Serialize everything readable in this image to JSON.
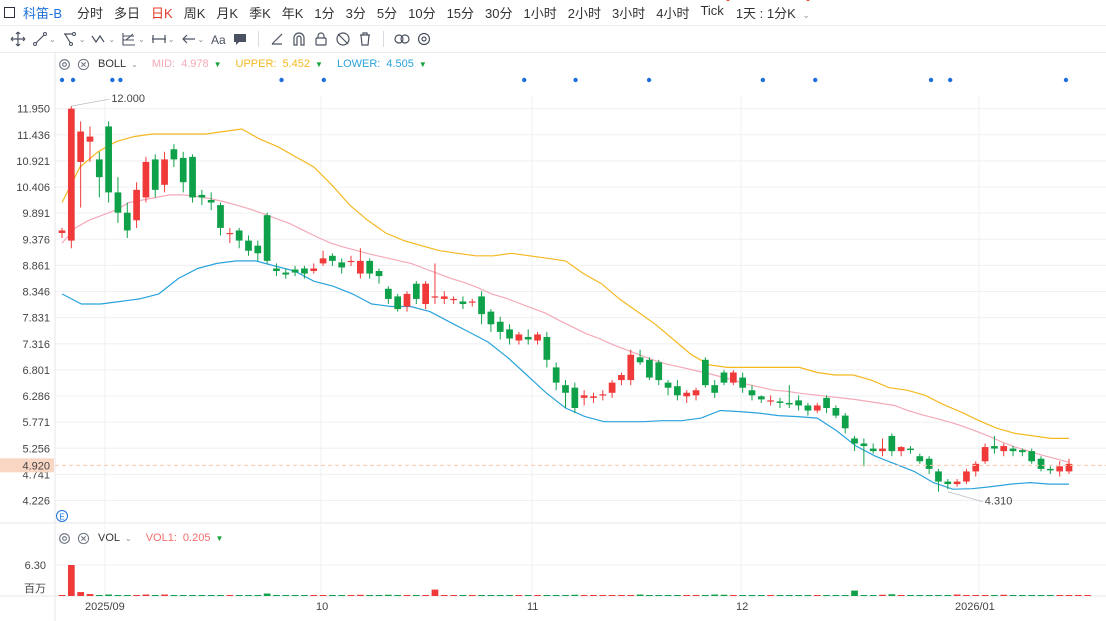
{
  "topbar": {
    "symbol": "科笛-B",
    "periods": [
      {
        "label": "分时",
        "active": false,
        "dot": false
      },
      {
        "label": "多日",
        "active": false,
        "dot": false
      },
      {
        "label": "日K",
        "active": true,
        "dot": false
      },
      {
        "label": "周K",
        "active": false,
        "dot": false
      },
      {
        "label": "月K",
        "active": false,
        "dot": false
      },
      {
        "label": "季K",
        "active": false,
        "dot": false
      },
      {
        "label": "年K",
        "active": false,
        "dot": false
      },
      {
        "label": "1分",
        "active": false,
        "dot": false
      },
      {
        "label": "3分",
        "active": false,
        "dot": false
      },
      {
        "label": "5分",
        "active": false,
        "dot": false
      },
      {
        "label": "10分",
        "active": false,
        "dot": false
      },
      {
        "label": "15分",
        "active": false,
        "dot": false
      },
      {
        "label": "30分",
        "active": false,
        "dot": false
      },
      {
        "label": "1小时",
        "active": false,
        "dot": false
      },
      {
        "label": "2小时",
        "active": false,
        "dot": false
      },
      {
        "label": "3小时",
        "active": false,
        "dot": false
      },
      {
        "label": "4小时",
        "active": false,
        "dot": false
      },
      {
        "label": "Tick",
        "active": false,
        "dot": true
      }
    ],
    "selector_label": "1天 : 1分K",
    "selector_dot": true
  },
  "toolbar": {
    "tools": [
      {
        "icon": "crosshair-move-icon",
        "caret": false
      },
      {
        "icon": "line-tool-icon",
        "caret": true
      },
      {
        "icon": "polyline-tool-icon",
        "caret": true
      },
      {
        "icon": "wave-pattern-icon",
        "caret": true
      },
      {
        "icon": "fibonacci-icon",
        "caret": true
      },
      {
        "icon": "measure-range-icon",
        "caret": true
      },
      {
        "icon": "arrow-left-icon",
        "caret": true
      },
      {
        "icon": "text-tool-icon",
        "caret": false
      },
      {
        "icon": "comment-icon",
        "caret": false
      },
      {
        "icon": "sep",
        "caret": false
      },
      {
        "icon": "angle-icon",
        "caret": false
      },
      {
        "icon": "magnet-icon",
        "caret": false
      },
      {
        "icon": "lock-icon",
        "caret": false
      },
      {
        "icon": "hide-icon",
        "caret": false
      },
      {
        "icon": "trash-icon",
        "caret": false
      },
      {
        "icon": "sep",
        "caret": false
      },
      {
        "icon": "link-icon",
        "caret": false
      },
      {
        "icon": "settings-icon",
        "caret": false
      }
    ]
  },
  "boll_legend": {
    "name": "BOLL",
    "mid_label": "MID:",
    "mid_value": "4.978",
    "upper_label": "UPPER:",
    "upper_value": "5.452",
    "lower_label": "LOWER:",
    "lower_value": "4.505",
    "colors": {
      "mid": "#f4a9b8",
      "upper": "#f5b821",
      "lower": "#2aa3dc"
    }
  },
  "vol_legend": {
    "name": "VOL",
    "vol1_label": "VOL1:",
    "vol1_value": "0.205",
    "color": "#f26d6d"
  },
  "price_axis": {
    "labels": [
      "11.950",
      "11.436",
      "10.921",
      "10.406",
      "9.891",
      "9.376",
      "8.861",
      "8.346",
      "7.831",
      "7.316",
      "6.801",
      "6.286",
      "5.771",
      "5.256",
      "4.741",
      "4.226"
    ],
    "current_price": "4.920"
  },
  "annotations": {
    "high_label": "12.000",
    "low_label": "4.310"
  },
  "volume_axis": {
    "max_label": "6.30",
    "unit_label": "百万"
  },
  "time_axis": {
    "labels": [
      "2025/09",
      "10",
      "11",
      "12",
      "2026/01"
    ]
  },
  "colors": {
    "up": "#f03a3a",
    "down": "#0fa14a",
    "bg": "#ffffff",
    "grid": "#eef0f3",
    "accent": "#1e6fd9",
    "price_line": "#f9c9ad",
    "price_tag": "#f9d6c4"
  },
  "chart_data": {
    "type": "candlestick",
    "title": "",
    "y_range": [
      4.0,
      12.2
    ],
    "candles": [
      [
        9.5,
        9.55,
        9.4,
        9.6
      ],
      [
        9.35,
        11.95,
        9.2,
        12.0
      ],
      [
        10.9,
        11.5,
        10.0,
        11.7
      ],
      [
        11.3,
        11.4,
        10.9,
        11.6
      ],
      [
        10.95,
        10.6,
        10.2,
        11.1
      ],
      [
        11.6,
        10.3,
        10.1,
        11.7
      ],
      [
        10.3,
        9.9,
        9.7,
        10.6
      ],
      [
        9.9,
        9.55,
        9.4,
        10.1
      ],
      [
        9.75,
        10.35,
        9.6,
        10.5
      ],
      [
        10.2,
        10.9,
        10.1,
        11.0
      ],
      [
        10.95,
        10.35,
        10.2,
        11.05
      ],
      [
        10.45,
        10.95,
        10.3,
        11.1
      ],
      [
        11.15,
        10.95,
        10.8,
        11.25
      ],
      [
        10.98,
        10.5,
        10.3,
        11.1
      ],
      [
        11.0,
        10.2,
        10.1,
        11.05
      ],
      [
        10.25,
        10.2,
        10.05,
        10.35
      ],
      [
        10.15,
        10.1,
        9.95,
        10.3
      ],
      [
        10.05,
        9.6,
        9.45,
        10.1
      ],
      [
        9.5,
        9.5,
        9.3,
        9.6
      ],
      [
        9.55,
        9.35,
        9.2,
        9.6
      ],
      [
        9.35,
        9.15,
        9.05,
        9.45
      ],
      [
        9.25,
        9.1,
        8.95,
        9.35
      ],
      [
        9.85,
        8.95,
        8.9,
        9.9
      ],
      [
        8.8,
        8.75,
        8.65,
        8.9
      ],
      [
        8.72,
        8.68,
        8.6,
        8.8
      ],
      [
        8.78,
        8.72,
        8.65,
        8.85
      ],
      [
        8.8,
        8.7,
        8.6,
        8.85
      ],
      [
        8.75,
        8.8,
        8.7,
        8.9
      ],
      [
        8.9,
        9.0,
        8.85,
        9.15
      ],
      [
        9.05,
        8.95,
        8.85,
        9.1
      ],
      [
        8.92,
        8.82,
        8.7,
        9.0
      ],
      [
        8.95,
        8.95,
        8.85,
        9.05
      ],
      [
        8.7,
        8.95,
        8.6,
        9.2
      ],
      [
        8.95,
        8.7,
        8.6,
        9.0
      ],
      [
        8.75,
        8.65,
        8.5,
        8.8
      ],
      [
        8.4,
        8.2,
        8.1,
        8.45
      ],
      [
        8.25,
        8.0,
        7.95,
        8.3
      ],
      [
        8.05,
        8.3,
        7.95,
        8.35
      ],
      [
        8.5,
        8.2,
        8.1,
        8.55
      ],
      [
        8.1,
        8.5,
        8.0,
        8.55
      ],
      [
        8.25,
        8.25,
        8.1,
        8.9
      ],
      [
        8.2,
        8.25,
        8.1,
        8.35
      ],
      [
        8.18,
        8.2,
        8.1,
        8.25
      ],
      [
        8.15,
        8.1,
        8.0,
        8.25
      ],
      [
        8.15,
        8.15,
        8.05,
        8.2
      ],
      [
        8.25,
        7.9,
        7.7,
        8.35
      ],
      [
        7.95,
        7.7,
        7.55,
        8.0
      ],
      [
        7.75,
        7.55,
        7.4,
        7.85
      ],
      [
        7.6,
        7.42,
        7.3,
        7.7
      ],
      [
        7.38,
        7.5,
        7.3,
        7.55
      ],
      [
        7.45,
        7.4,
        7.3,
        7.6
      ],
      [
        7.38,
        7.5,
        7.3,
        7.55
      ],
      [
        7.45,
        7.0,
        6.85,
        7.55
      ],
      [
        6.85,
        6.55,
        6.4,
        6.95
      ],
      [
        6.5,
        6.35,
        6.05,
        6.6
      ],
      [
        6.45,
        6.05,
        5.95,
        6.55
      ],
      [
        6.25,
        6.3,
        6.1,
        6.4
      ],
      [
        6.25,
        6.28,
        6.15,
        6.35
      ],
      [
        6.3,
        6.32,
        6.2,
        6.4
      ],
      [
        6.35,
        6.55,
        6.25,
        6.6
      ],
      [
        6.6,
        6.7,
        6.5,
        6.75
      ],
      [
        6.6,
        7.1,
        6.5,
        7.2
      ],
      [
        7.05,
        6.95,
        6.9,
        7.2
      ],
      [
        7.0,
        6.65,
        6.6,
        7.05
      ],
      [
        6.95,
        6.6,
        6.5,
        7.0
      ],
      [
        6.55,
        6.45,
        6.3,
        6.6
      ],
      [
        6.48,
        6.3,
        6.2,
        6.6
      ],
      [
        6.28,
        6.35,
        6.15,
        6.4
      ],
      [
        6.3,
        6.4,
        6.2,
        6.45
      ],
      [
        7.0,
        6.5,
        6.45,
        7.05
      ],
      [
        6.5,
        6.35,
        6.25,
        6.6
      ],
      [
        6.75,
        6.55,
        6.5,
        6.8
      ],
      [
        6.55,
        6.75,
        6.5,
        6.8
      ],
      [
        6.65,
        6.45,
        6.35,
        6.75
      ],
      [
        6.4,
        6.3,
        6.2,
        6.5
      ],
      [
        6.28,
        6.22,
        6.15,
        6.3
      ],
      [
        6.2,
        6.2,
        6.1,
        6.3
      ],
      [
        6.18,
        6.15,
        6.05,
        6.25
      ],
      [
        6.15,
        6.12,
        6.05,
        6.5
      ],
      [
        6.2,
        6.1,
        6.0,
        6.3
      ],
      [
        6.1,
        6.0,
        5.9,
        6.15
      ],
      [
        6.0,
        6.1,
        5.95,
        6.15
      ],
      [
        6.25,
        6.05,
        5.95,
        6.3
      ],
      [
        6.05,
        5.9,
        5.85,
        6.1
      ],
      [
        5.9,
        5.65,
        5.55,
        5.95
      ],
      [
        5.45,
        5.35,
        5.2,
        5.5
      ],
      [
        5.35,
        5.3,
        4.9,
        5.45
      ],
      [
        5.25,
        5.2,
        5.15,
        5.35
      ],
      [
        5.2,
        5.25,
        5.1,
        5.45
      ],
      [
        5.5,
        5.2,
        5.1,
        5.55
      ],
      [
        5.2,
        5.28,
        5.1,
        5.3
      ],
      [
        5.25,
        5.22,
        5.15,
        5.3
      ],
      [
        5.1,
        5.0,
        4.95,
        5.15
      ],
      [
        5.05,
        4.85,
        4.75,
        5.1
      ],
      [
        4.8,
        4.6,
        4.4,
        4.85
      ],
      [
        4.6,
        4.55,
        4.45,
        4.65
      ],
      [
        4.55,
        4.6,
        4.5,
        4.65
      ],
      [
        4.6,
        4.8,
        4.55,
        4.85
      ],
      [
        4.8,
        4.95,
        4.7,
        5.0
      ],
      [
        5.0,
        5.28,
        4.95,
        5.35
      ],
      [
        5.3,
        5.25,
        5.15,
        5.5
      ],
      [
        5.2,
        5.3,
        5.1,
        5.35
      ],
      [
        5.25,
        5.2,
        5.1,
        5.3
      ],
      [
        5.22,
        5.18,
        5.1,
        5.25
      ],
      [
        5.2,
        5.0,
        4.95,
        5.25
      ],
      [
        5.05,
        4.85,
        4.8,
        5.1
      ],
      [
        4.85,
        4.82,
        4.75,
        4.9
      ],
      [
        4.8,
        4.9,
        4.7,
        5.0
      ],
      [
        4.8,
        4.95,
        4.75,
        5.05
      ]
    ],
    "boll": {
      "mid": [
        9.3,
        9.6,
        9.75,
        9.85,
        9.95,
        10.1,
        10.15,
        10.2,
        10.25,
        10.25,
        10.22,
        10.18,
        10.12,
        10.05,
        9.97,
        9.88,
        9.78,
        9.68,
        9.55,
        9.42,
        9.3,
        9.22,
        9.15,
        9.08,
        9.02,
        8.96,
        8.9,
        8.8,
        8.7,
        8.6,
        8.52,
        8.42,
        8.3,
        8.22,
        8.12,
        8.02,
        7.92,
        7.78,
        7.65,
        7.52,
        7.42,
        7.3,
        7.2,
        7.1,
        7.0,
        6.92,
        6.86,
        6.8,
        6.74,
        6.67,
        6.6,
        6.52,
        6.46,
        6.4,
        6.38,
        6.34,
        6.31,
        6.28,
        6.25,
        6.22,
        6.18,
        6.14,
        6.1,
        6.0,
        5.92,
        5.85,
        5.78,
        5.7,
        5.6,
        5.5,
        5.38,
        5.28,
        5.2,
        5.12,
        5.05,
        4.98
      ],
      "upper": [
        10.1,
        10.8,
        11.1,
        11.3,
        11.4,
        11.45,
        11.45,
        11.45,
        11.45,
        11.5,
        11.55,
        11.35,
        11.2,
        11.0,
        10.8,
        10.45,
        10.05,
        9.75,
        9.5,
        9.35,
        9.25,
        9.15,
        9.1,
        9.05,
        9.05,
        9.1,
        9.05,
        9.0,
        8.95,
        8.7,
        8.5,
        8.2,
        7.95,
        7.7,
        7.4,
        7.1,
        6.9,
        6.85,
        6.85,
        6.85,
        6.85,
        6.85,
        6.75,
        6.7,
        6.7,
        6.6,
        6.45,
        6.4,
        6.3,
        6.12,
        5.97,
        5.8,
        5.65,
        5.55,
        5.5,
        5.45,
        5.45
      ],
      "lower": [
        8.3,
        8.1,
        8.1,
        8.15,
        8.2,
        8.3,
        8.6,
        8.8,
        8.9,
        8.95,
        8.95,
        8.85,
        8.75,
        8.55,
        8.45,
        8.3,
        8.1,
        8.05,
        8.05,
        7.95,
        7.75,
        7.55,
        7.35,
        7.05,
        6.7,
        6.35,
        6.05,
        5.88,
        5.78,
        5.78,
        5.78,
        5.8,
        5.8,
        5.85,
        6.0,
        5.98,
        5.95,
        5.9,
        5.88,
        5.85,
        5.6,
        5.3,
        5.1,
        4.95,
        4.8,
        4.58,
        4.45,
        4.46,
        4.5,
        4.55,
        4.58,
        4.55,
        4.55
      ]
    },
    "volume_millions": [
      0.1,
      6.3,
      0.8,
      0.4,
      0.2,
      0.3,
      0.2,
      0.15,
      0.2,
      0.3,
      0.2,
      0.3,
      0.15,
      0.2,
      0.1,
      0.2,
      0.1,
      0.15,
      0.1,
      0.1,
      0.15,
      0.1,
      0.5,
      0.15,
      0.1,
      0.1,
      0.1,
      0.1,
      0.2,
      0.1,
      0.1,
      0.1,
      0.25,
      0.1,
      0.15,
      0.25,
      0.2,
      0.1,
      0.1,
      0.1,
      1.3,
      0.1,
      0.2,
      0.1,
      0.1,
      0.15,
      0.2,
      0.15,
      0.1,
      0.1,
      0.1,
      0.1,
      0.2,
      0.15,
      0.2,
      0.25,
      0.15,
      0.1,
      0.1,
      0.1,
      0.1,
      0.1,
      0.3,
      0.15,
      0.15,
      0.1,
      0.15,
      0.1,
      0.1,
      0.1,
      0.3,
      0.25,
      0.2,
      0.15,
      0.1,
      0.1,
      0.1,
      0.1,
      0.1,
      0.15,
      0.1,
      0.1,
      0.15,
      0.1,
      0.1,
      1.1,
      0.15,
      0.2,
      0.25,
      0.35,
      0.15,
      0.1,
      0.1,
      0.15,
      0.1,
      0.2,
      0.3,
      0.15,
      0.1,
      0.1,
      0.2,
      0.25,
      0.15,
      0.1,
      0.1,
      0.2,
      0.15,
      0.1,
      0.1,
      0.2,
      0.2
    ]
  }
}
